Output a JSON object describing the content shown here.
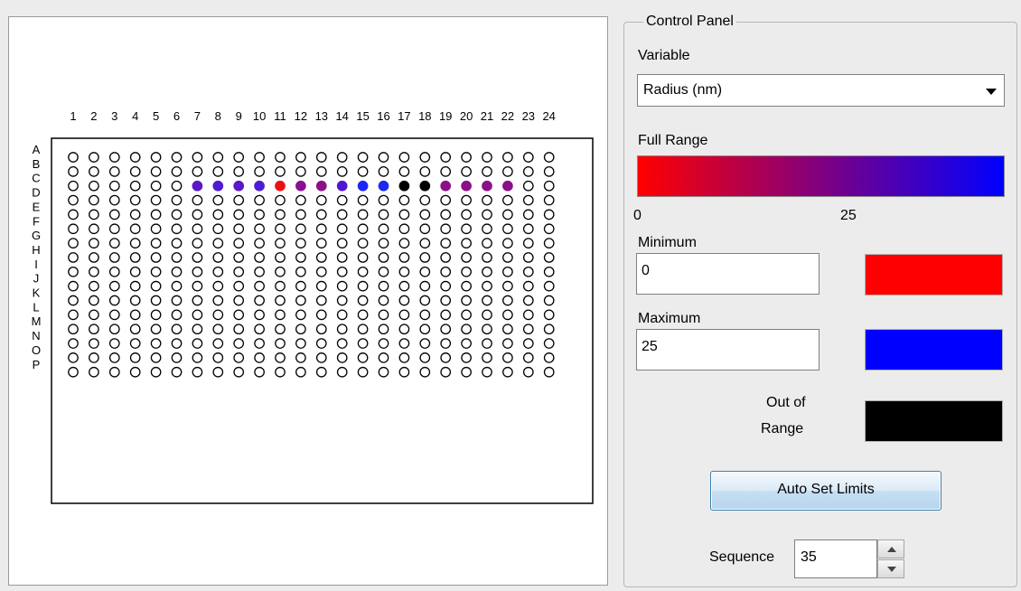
{
  "plate": {
    "columns": [
      "1",
      "2",
      "3",
      "4",
      "5",
      "6",
      "7",
      "8",
      "9",
      "10",
      "11",
      "12",
      "13",
      "14",
      "15",
      "16",
      "17",
      "18",
      "19",
      "20",
      "21",
      "22",
      "23",
      "24"
    ],
    "rows": [
      "A",
      "B",
      "C",
      "D",
      "E",
      "F",
      "G",
      "H",
      "I",
      "J",
      "K",
      "L",
      "M",
      "N",
      "O",
      "P"
    ],
    "filled_wells": [
      {
        "row": "C",
        "col": 7,
        "color": "#5a18c6"
      },
      {
        "row": "C",
        "col": 8,
        "color": "#4f1cd2"
      },
      {
        "row": "C",
        "col": 9,
        "color": "#5a18c8"
      },
      {
        "row": "C",
        "col": 10,
        "color": "#4a1ed6"
      },
      {
        "row": "C",
        "col": 11,
        "color": "#ee1010"
      },
      {
        "row": "C",
        "col": 12,
        "color": "#8a1092"
      },
      {
        "row": "C",
        "col": 13,
        "color": "#8c1088"
      },
      {
        "row": "C",
        "col": 14,
        "color": "#5016d0"
      },
      {
        "row": "C",
        "col": 15,
        "color": "#1e26f4"
      },
      {
        "row": "C",
        "col": 16,
        "color": "#1e26f4"
      },
      {
        "row": "C",
        "col": 17,
        "color": "#000000"
      },
      {
        "row": "C",
        "col": 18,
        "color": "#000000"
      },
      {
        "row": "C",
        "col": 19,
        "color": "#8c1088"
      },
      {
        "row": "C",
        "col": 20,
        "color": "#8c1088"
      },
      {
        "row": "C",
        "col": 21,
        "color": "#8c1088"
      },
      {
        "row": "C",
        "col": 22,
        "color": "#8c1088"
      }
    ]
  },
  "control_panel": {
    "title": "Control Panel",
    "variable_label": "Variable",
    "variable_selected": "Radius (nm)",
    "full_range_label": "Full Range",
    "range_min_tick": "0",
    "range_max_tick": "25",
    "minimum_label": "Minimum",
    "minimum_value": "0",
    "minimum_color": "#ff0000",
    "maximum_label": "Maximum",
    "maximum_value": "25",
    "maximum_color": "#0000ff",
    "out_of_range_label_1": "Out of",
    "out_of_range_label_2": "Range",
    "out_of_range_color": "#000000",
    "auto_set_button": "Auto Set Limits",
    "sequence_label": "Sequence",
    "sequence_value": "35"
  }
}
